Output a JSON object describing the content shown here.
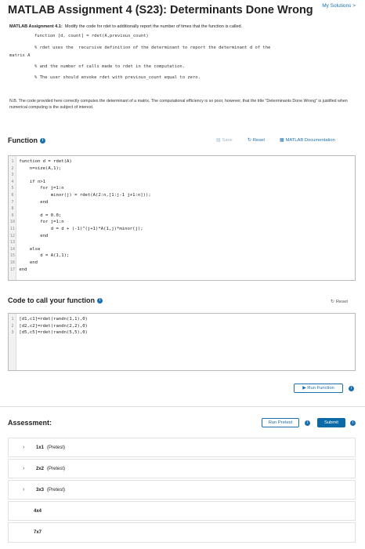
{
  "header": {
    "title": "MATLAB Assignment 4 (S23): Determinants Done Wrong",
    "my_solutions": "My Solutions >"
  },
  "description": {
    "label": "MATLAB Assignment 4.1:",
    "text": "Modify the code for rdet to additionally report the number of times that the function is called.",
    "line1": "function [d, count] = rdet(A,previous_count)",
    "line2": "% rdet uses the  recursive definition of the determinant to report the determinant d of the",
    "line3": "matrix A",
    "line4": "% and the number of calls made to rdet in the computation.",
    "line5": "% The user should envoke rdet with previous_count equal to zero."
  },
  "note": {
    "text": "N.B. The code provided here correctly computes the determinant of a matrix.  The computational efficiency is so poor, however, that the title \"Determinants Done Wrong\" is justified when numerical computing is the subject of interest."
  },
  "function_section": {
    "title": "Function",
    "save": "Save",
    "reset": "Reset",
    "docs": "MATLAB Documentation",
    "lines": [
      {
        "n": "1",
        "code": "function d = rdet(A)"
      },
      {
        "n": "2",
        "code": "    n=size(A,1);"
      },
      {
        "n": "3",
        "code": ""
      },
      {
        "n": "4",
        "code": "    if n>1"
      },
      {
        "n": "5",
        "code": "        for j=1:n"
      },
      {
        "n": "6",
        "code": "            minor(j) = rdet(A(2:n,[1:j-1 j+1:n]));"
      },
      {
        "n": "7",
        "code": "        end"
      },
      {
        "n": "8",
        "code": ""
      },
      {
        "n": "9",
        "code": "        d = 0.0;"
      },
      {
        "n": "10",
        "code": "        for j=1:n"
      },
      {
        "n": "11",
        "code": "            d = d + (-1)^(j+1)*A(1,j)*minor(j);"
      },
      {
        "n": "12",
        "code": "        end"
      },
      {
        "n": "13",
        "code": ""
      },
      {
        "n": "14",
        "code": "    else"
      },
      {
        "n": "15",
        "code": "        d = A(1,1);"
      },
      {
        "n": "16",
        "code": "    end"
      },
      {
        "n": "17",
        "code": "end"
      }
    ]
  },
  "call_section": {
    "title": "Code to call your function",
    "reset": "Reset",
    "lines": [
      {
        "n": "1",
        "code": "[d1,c1]=rdet(randn(1,1),0)"
      },
      {
        "n": "2",
        "code": "[d2,c2]=rdet(randn(2,2),0)"
      },
      {
        "n": "3",
        "code": "[d5,c5]=rdet(randn(5,5),0)"
      }
    ],
    "run_function": "Run Function"
  },
  "assessment": {
    "title": "Assessment:",
    "run_pretest": "Run Pretest",
    "submit": "Submit",
    "items": [
      {
        "name": "1x1",
        "tag": "(Pretest)"
      },
      {
        "name": "2x2",
        "tag": "(Pretest)"
      },
      {
        "name": "3x3",
        "tag": "(Pretest)"
      },
      {
        "name": "4x4",
        "tag": ""
      },
      {
        "name": "7x7",
        "tag": ""
      }
    ]
  },
  "colors": {
    "accent": "#1a6fb0",
    "submit": "#0a6aa8"
  },
  "icons": [
    "info-icon",
    "save-icon",
    "reset-icon",
    "documentation-icon",
    "play-icon",
    "chevron-right-icon"
  ]
}
